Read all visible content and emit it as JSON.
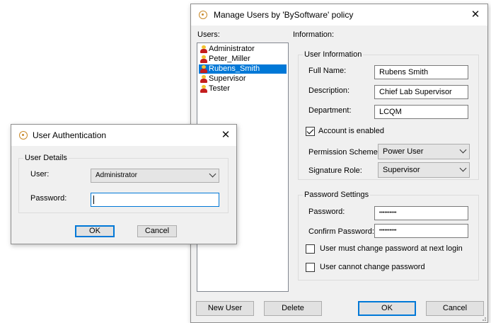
{
  "manage": {
    "title": "Manage Users by 'BySoftware' policy",
    "close_glyph": "✕",
    "users_label": "Users:",
    "info_label": "Information:",
    "users": [
      "Administrator",
      "Peter_Miller",
      "Rubens_Smith",
      "Supervisor",
      "Tester"
    ],
    "selected_user": "Rubens_Smith",
    "user_info": {
      "group_title": "User Information",
      "full_name_label": "Full Name:",
      "full_name": "Rubens Smith",
      "description_label": "Description:",
      "description": "Chief Lab Supervisor",
      "department_label": "Department:",
      "department": "LCQM",
      "account_enabled_label": "Account is enabled",
      "account_enabled": true,
      "permission_label": "Permission Scheme:",
      "permission": "Power User",
      "signature_label": "Signature Role:",
      "signature": "Supervisor"
    },
    "password_settings": {
      "group_title": "Password Settings",
      "password_label": "Password:",
      "password_mask": "••••••••••",
      "confirm_label": "Confirm Password:",
      "confirm_mask": "••••••••••",
      "must_change_label": "User must change password at next login",
      "must_change": false,
      "cannot_change_label": "User cannot change password",
      "cannot_change": false
    },
    "buttons": {
      "new_user": "New User",
      "delete": "Delete",
      "ok": "OK",
      "cancel": "Cancel"
    }
  },
  "auth": {
    "title": "User Authentication",
    "close_glyph": "✕",
    "group_title": "User Details",
    "user_label": "User:",
    "user": "Administrator",
    "password_label": "Password:",
    "password": "",
    "buttons": {
      "ok": "OK",
      "cancel": "Cancel"
    }
  },
  "colors": {
    "selection": "#0078d7",
    "dialog_bg": "#f0f0f0",
    "title_icon": "#c98a2b",
    "user_icon_head": "#f2c230",
    "user_icon_body": "#c41d1d"
  }
}
